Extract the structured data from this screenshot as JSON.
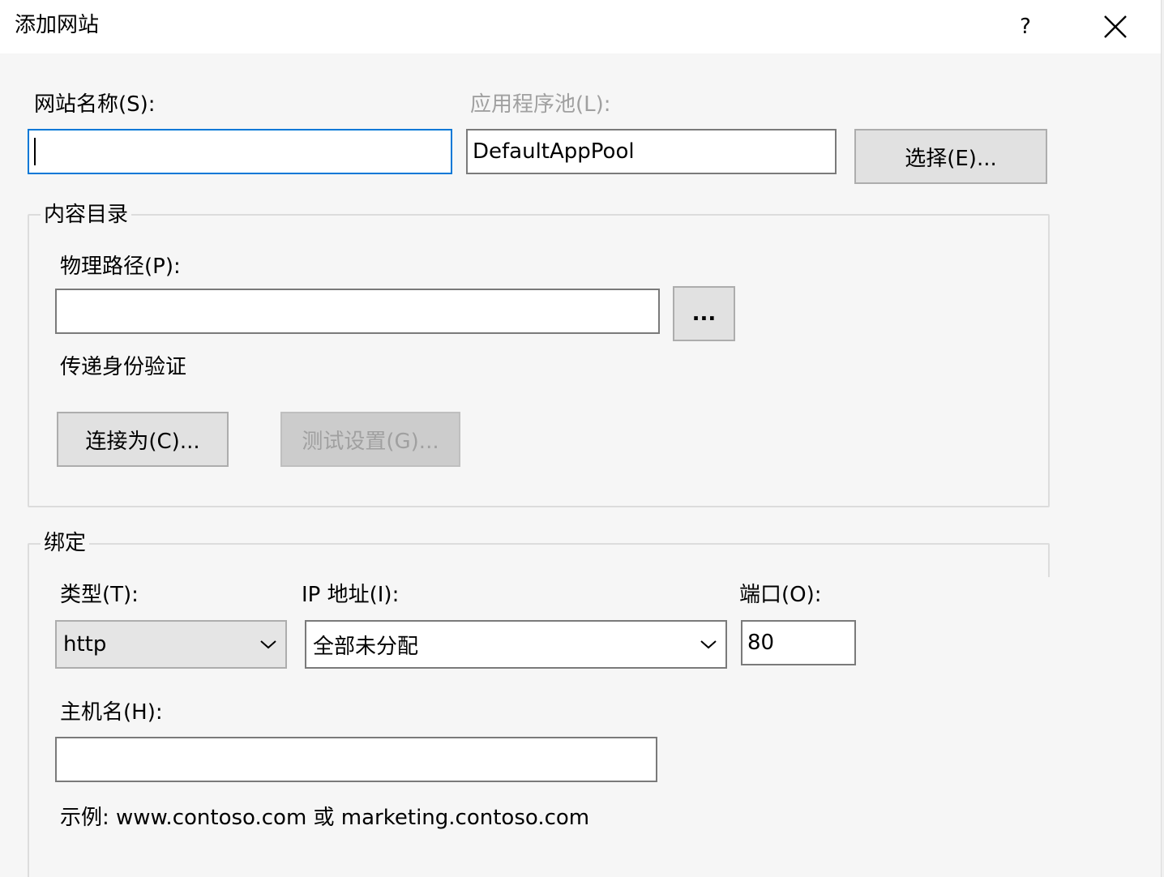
{
  "window": {
    "title": "添加网站",
    "help_label": "?",
    "close_icon": "close-icon"
  },
  "site": {
    "name_label": "网站名称(S):",
    "name_value": "",
    "app_pool_label": "应用程序池(L):",
    "app_pool_value": "DefaultAppPool",
    "select_button": "选择(E)..."
  },
  "content": {
    "group_label": "内容目录",
    "physical_path_label": "物理路径(P):",
    "physical_path_value": "",
    "browse_button": "...",
    "passthrough_label": "传递身份验证",
    "connect_as_button": "连接为(C)...",
    "test_settings_button": "测试设置(G)..."
  },
  "binding": {
    "group_label": "绑定",
    "type_label": "类型(T):",
    "type_value": "http",
    "ip_label": "IP 地址(I):",
    "ip_value": "全部未分配",
    "port_label": "端口(O):",
    "port_value": "80",
    "host_label": "主机名(H):",
    "host_value": "",
    "example_text": "示例: www.contoso.com 或 marketing.contoso.com"
  }
}
